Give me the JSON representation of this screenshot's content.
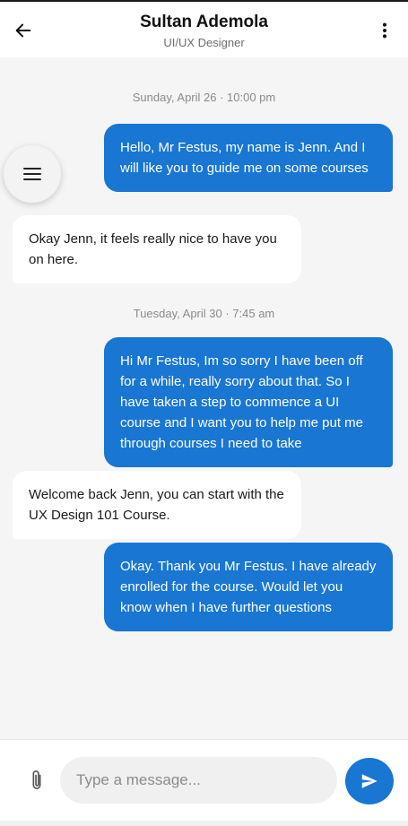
{
  "header": {
    "name": "Sultan Ademola",
    "role": "UI/UX Designer",
    "back_icon": "arrow-left-icon",
    "more_icon": "more-vertical-icon"
  },
  "messages": {
    "timestamp_1": "Sunday, April 26 · 10:00 pm",
    "msg_1": "Hello, Mr Festus, my name is Jenn. And I will like you to guide me on some courses",
    "msg_2": "Okay Jenn, it feels really nice to have you on here.",
    "timestamp_2": "Tuesday, April 30 · 7:45 am",
    "msg_3": "Hi Mr Festus, Im so sorry I have been off for a while, really sorry about that. So I have taken a step to commence a UI course and I want you to help me put me through courses I need to take",
    "msg_4": "Welcome back Jenn, you can start with the UX Design 101 Course.",
    "msg_5": "Okay. Thank you Mr Festus. I have already enrolled for the course. Would let you know when I have further questions"
  },
  "composer": {
    "placeholder": "Type a message...",
    "attach_icon": "paperclip-icon",
    "send_icon": "send-icon"
  },
  "menu_icon": "menu-icon",
  "colors": {
    "accent": "#1976d2",
    "background": "#f5f5f6",
    "incoming_bubble": "#ffffff"
  }
}
